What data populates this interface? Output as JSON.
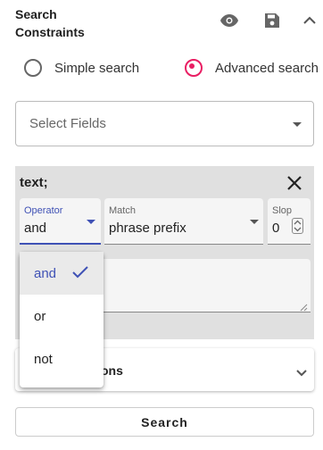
{
  "header": {
    "title_line1": "Search",
    "title_line2": "Constraints",
    "icons": [
      "eye-icon",
      "save-icon",
      "chevron-up-icon"
    ]
  },
  "search_mode": {
    "options": [
      {
        "label": "Simple search",
        "selected": false
      },
      {
        "label": "Advanced search",
        "selected": true
      }
    ],
    "accent_color": "#e91e63"
  },
  "select_fields": {
    "placeholder": "Select Fields"
  },
  "constraint": {
    "title": "text;",
    "operator": {
      "label": "Operator",
      "value": "and"
    },
    "match": {
      "label": "Match",
      "value": "phrase prefix"
    },
    "slop": {
      "label": "Slop",
      "value": "0"
    }
  },
  "operator_menu": {
    "items": [
      {
        "label": "and",
        "selected": true
      },
      {
        "label": "or",
        "selected": false
      },
      {
        "label": "not",
        "selected": false
      }
    ],
    "accent_color": "#3f51b5"
  },
  "lower_section": {
    "label_visible": "ons"
  },
  "search_button": {
    "label": "Search"
  }
}
